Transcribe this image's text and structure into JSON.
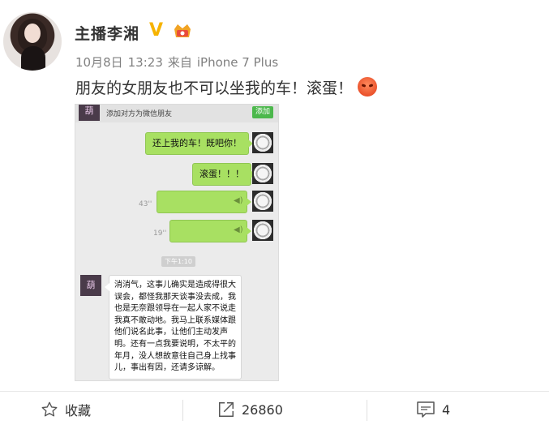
{
  "post": {
    "username": "主播李湘",
    "verified_badge": "V",
    "date": "10月8日",
    "time": "13:23",
    "source_prefix": "来自",
    "source": "iPhone 7 Plus",
    "text": "朋友的女朋友也不可以坐我的车！滚蛋！",
    "emoji": "angry-face-emoji"
  },
  "chat": {
    "header_title": "添加对方为微信朋友",
    "add_label": "添加",
    "contact_avatar_text": "葫",
    "messages": [
      "还上我的车！既吧你！",
      "滚蛋！！！"
    ],
    "voice_messages": [
      {
        "duration": "43''"
      },
      {
        "duration": "19''"
      }
    ],
    "timestamp": "下午1:10",
    "reply": "消消气，这事儿确实是造成得很大误会，都怪我那天谈事没去成，我也是无奈跟领导在一起人家不说走我真不敢动地。我马上联系媒体跟他们说名此事，让他们主动发声明。还有一点我要说明，不太平的年月，没人想故意往自己身上找事儿，事出有因，还请多谅解。"
  },
  "footer": {
    "favorite_label": "收藏",
    "repost_count": "26860",
    "comment_count": "4"
  },
  "colors": {
    "bubble_green": "#a8e062",
    "add_button": "#4cb84c",
    "verified_gold": "#f6b300"
  }
}
